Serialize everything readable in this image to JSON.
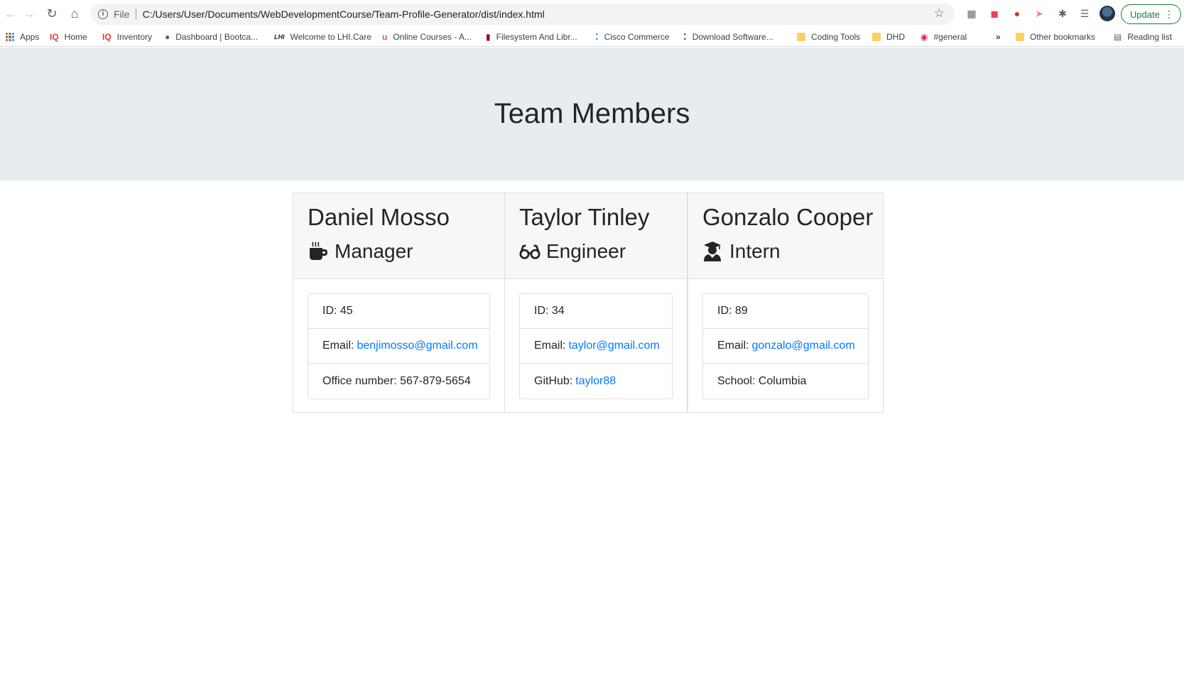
{
  "browser": {
    "url_scheme": "File",
    "url": "C:/Users/User/Documents/WebDevelopmentCourse/Team-Profile-Generator/dist/index.html",
    "update_label": "Update",
    "bookmarks": [
      {
        "label": "Apps",
        "icon": "apps-grid-icon"
      },
      {
        "label": "Home",
        "icon": "iq-icon"
      },
      {
        "label": "Inventory",
        "icon": "iq-icon"
      },
      {
        "label": "Dashboard | Bootca...",
        "icon": "globe-icon"
      },
      {
        "label": "Welcome to LHI.Care",
        "icon": "lhi-icon"
      },
      {
        "label": "Online Courses - A...",
        "icon": "udemy-icon"
      },
      {
        "label": "Filesystem And Libr...",
        "icon": "page-icon"
      },
      {
        "label": "Cisco Commerce",
        "icon": "cisco-icon"
      },
      {
        "label": "Download Software...",
        "icon": "cisco-icon"
      },
      {
        "label": "Coding Tools",
        "icon": "folder-icon"
      },
      {
        "label": "DHD",
        "icon": "folder-icon"
      },
      {
        "label": "#general",
        "icon": "slack-icon"
      }
    ],
    "overflow_label": "»",
    "other_bookmarks": "Other bookmarks",
    "reading_list": "Reading list"
  },
  "page": {
    "title": "Team Members"
  },
  "employees": [
    {
      "name": "Daniel Mosso",
      "role": "Manager",
      "role_icon": "coffee-mug-icon",
      "id_label": "ID: 45",
      "email_label": "Email:",
      "email": "benjimosso@gmail.com",
      "extra_label": "Office number: 567-879-5654",
      "extra_link": ""
    },
    {
      "name": "Taylor Tinley",
      "role": "Engineer",
      "role_icon": "glasses-icon",
      "id_label": "ID: 34",
      "email_label": "Email:",
      "email": "taylor@gmail.com",
      "extra_label": "GitHub:",
      "extra_link": "taylor88"
    },
    {
      "name": "Gonzalo Cooper",
      "role": "Intern",
      "role_icon": "graduate-icon",
      "id_label": "ID: 89",
      "email_label": "Email:",
      "email": "gonzalo@gmail.com",
      "extra_label": "School: Columbia",
      "extra_link": ""
    }
  ],
  "colors": {
    "link": "#007bff",
    "jumbotron_bg": "#e9ecef",
    "card_header_bg": "#f7f7f7"
  }
}
